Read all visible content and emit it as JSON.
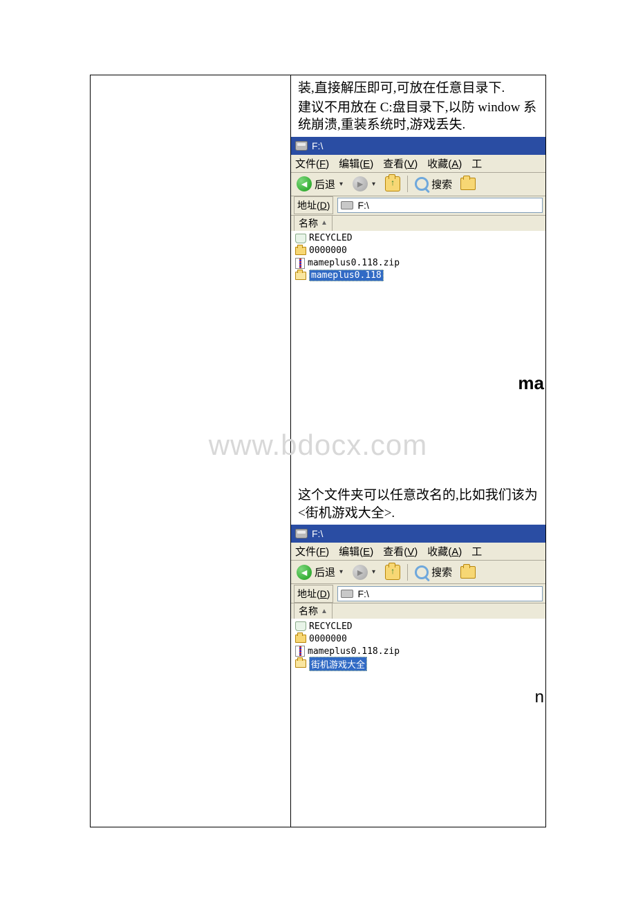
{
  "watermark": "www.bdocx.com",
  "para1": "装,直接解压即可,可放在任意目录下.",
  "para2": "建议不用放在 C:盘目录下,以防 window 系统崩溃,重装系统时,游戏丢失.",
  "para3": "这个文件夹可以任意改名的,比如我们该为<街机游戏大全>.",
  "explorer": {
    "title": "F:\\",
    "menu": {
      "file": "文件(F)",
      "edit": "编辑(E)",
      "view": "查看(V)",
      "fav": "收藏(A)",
      "tools_hint": "工"
    },
    "toolbar": {
      "back": "后退",
      "search": "搜索"
    },
    "addr": {
      "label": "地址(D)",
      "value": "F:\\"
    },
    "col": "名称",
    "files_a": {
      "recycled": "RECYCLED",
      "folder0": "0000000",
      "zip": "mameplus0.118.zip",
      "sel": "mameplus0.118"
    },
    "files_b": {
      "recycled": "RECYCLED",
      "folder0": "0000000",
      "zip": "mameplus0.118.zip",
      "sel": "街机游戏大全"
    },
    "crop_a": "ma",
    "crop_b": "n"
  }
}
